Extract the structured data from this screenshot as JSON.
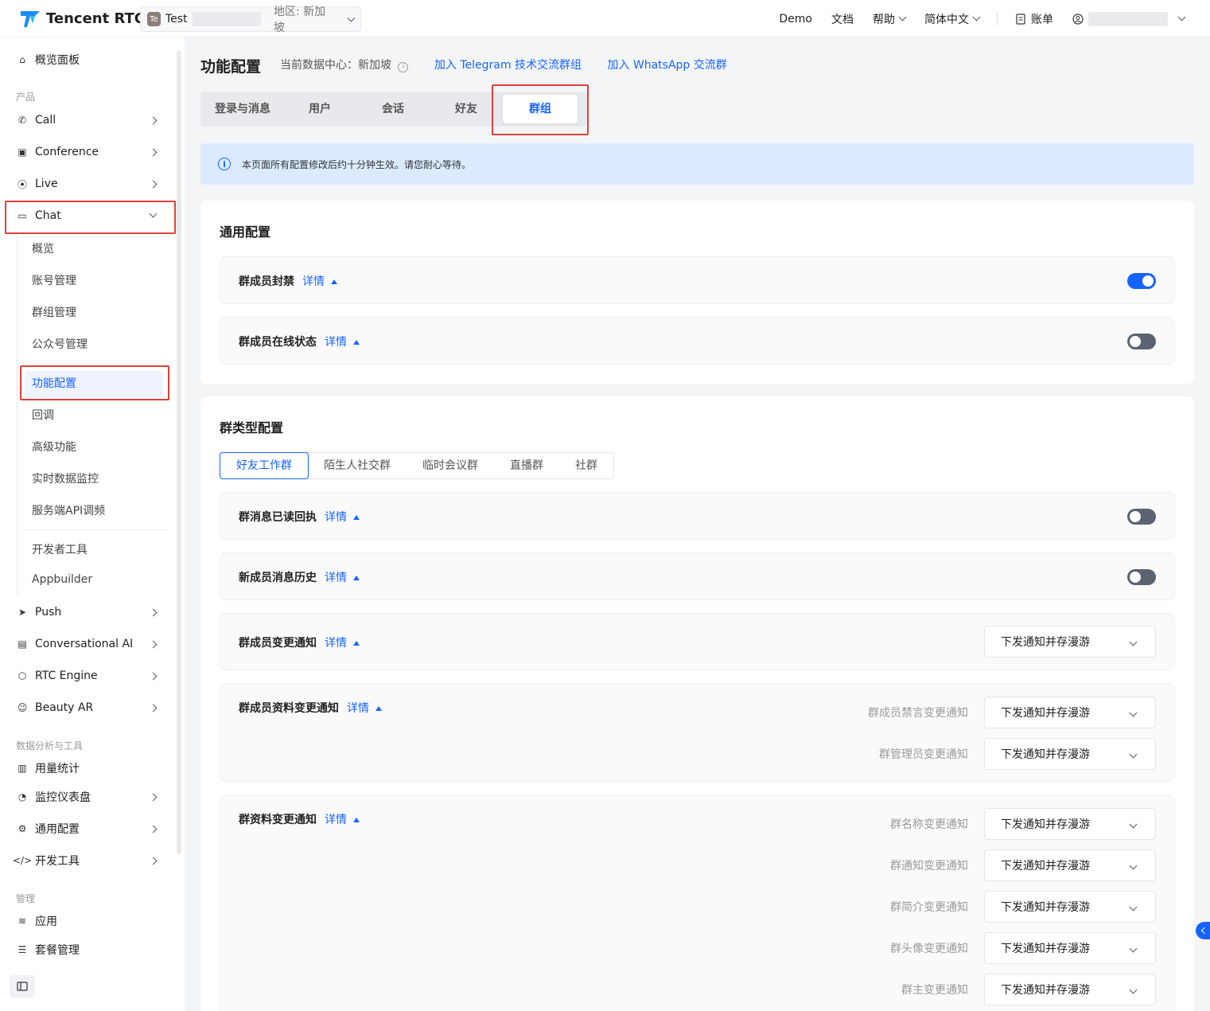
{
  "header": {
    "logo": "Tencent RTC",
    "project": {
      "badge": "Te",
      "name": "Test",
      "region": "地区: 新加坡"
    },
    "nav": [
      "Demo",
      "文档",
      "帮助",
      "简体中文"
    ],
    "billing": "账单"
  },
  "sidebar": {
    "overview": "概览面板",
    "section_product": "产品",
    "products": [
      "Call",
      "Conference",
      "Live",
      "Chat"
    ],
    "chat_sub": [
      "概览",
      "账号管理",
      "群组管理",
      "公众号管理",
      "功能配置",
      "回调",
      "高级功能",
      "实时数据监控",
      "服务端API调频",
      "开发者工具",
      "Appbuilder"
    ],
    "products2": [
      "Push",
      "Conversational AI",
      "RTC Engine",
      "Beauty AR"
    ],
    "section_data": "数据分析与工具",
    "data_items": [
      "用量统计",
      "监控仪表盘",
      "通用配置",
      "开发工具"
    ],
    "section_manage": "管理",
    "manage_items": [
      "应用",
      "套餐管理"
    ]
  },
  "main": {
    "title": "功能配置",
    "datacenter": "当前数据中心：新加坡",
    "links": [
      "加入 Telegram 技术交流群组",
      "加入 WhatsApp 交流群"
    ],
    "tabs": [
      "登录与消息",
      "用户",
      "会话",
      "好友",
      "群组"
    ],
    "notice": "本页面所有配置修改后约十分钟生效。请您耐心等待。",
    "general": {
      "title": "通用配置",
      "rows": [
        {
          "label": "群成员封禁",
          "detail": "详情",
          "on": true
        },
        {
          "label": "群成员在线状态",
          "detail": "详情",
          "on": false
        }
      ]
    },
    "group_type": {
      "title": "群类型配置",
      "tabs": [
        "好友工作群",
        "陌生人社交群",
        "临时会议群",
        "直播群",
        "社群"
      ],
      "rows": [
        {
          "label": "群消息已读回执",
          "detail": "详情"
        },
        {
          "label": "新成员消息历史",
          "detail": "详情"
        },
        {
          "label": "群成员变更通知",
          "detail": "详情",
          "value": "下发通知并存漫游"
        },
        {
          "label": "群成员资料变更通知",
          "detail": "详情",
          "subs": [
            {
              "name": "群成员禁言变更通知",
              "value": "下发通知并存漫游"
            },
            {
              "name": "群管理员变更通知",
              "value": "下发通知并存漫游"
            }
          ]
        },
        {
          "label": "群资料变更通知",
          "detail": "详情",
          "subs": [
            {
              "name": "群名称变更通知",
              "value": "下发通知并存漫游"
            },
            {
              "name": "群通知变更通知",
              "value": "下发通知并存漫游"
            },
            {
              "name": "群简介变更通知",
              "value": "下发通知并存漫游"
            },
            {
              "name": "群头像变更通知",
              "value": "下发通知并存漫游"
            },
            {
              "name": "群主变更通知",
              "value": "下发通知并存漫游"
            }
          ]
        }
      ]
    }
  },
  "colors": {
    "accent": "#1664ff",
    "highlight": "#e0403a"
  }
}
